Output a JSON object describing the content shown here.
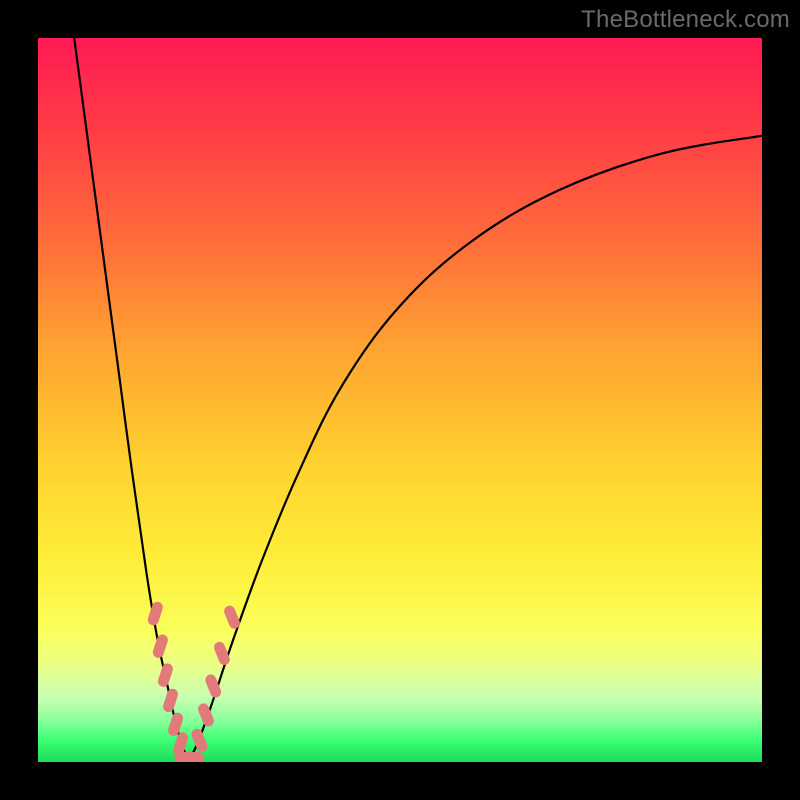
{
  "watermark": "TheBottleneck.com",
  "chart_data": {
    "type": "line",
    "title": "",
    "xlabel": "",
    "ylabel": "",
    "xlim": [
      0,
      100
    ],
    "ylim": [
      0,
      100
    ],
    "series": [
      {
        "name": "left-branch",
        "x": [
          5,
          7,
          9,
          11,
          13,
          15,
          16.5,
          18,
          19,
          20,
          20.8
        ],
        "y": [
          100,
          85,
          70,
          55,
          40,
          26,
          17,
          10,
          5.5,
          2,
          0.3
        ]
      },
      {
        "name": "right-branch",
        "x": [
          20.8,
          22,
          24,
          27,
          31,
          36,
          42,
          50,
          60,
          72,
          86,
          100
        ],
        "y": [
          0.3,
          2.5,
          8,
          17,
          28,
          40,
          52,
          63,
          72,
          79,
          84,
          86.5
        ]
      }
    ],
    "annotations": {
      "marker_cluster_description": "salmon-colored rounded dash markers clustered near the valley bottom on both branches",
      "marker_color": "#e27a7a",
      "markers": [
        {
          "branch": "left",
          "x": 16.2,
          "y": 20.5
        },
        {
          "branch": "left",
          "x": 16.9,
          "y": 16.0
        },
        {
          "branch": "left",
          "x": 17.6,
          "y": 12.0
        },
        {
          "branch": "left",
          "x": 18.3,
          "y": 8.5
        },
        {
          "branch": "left",
          "x": 19.0,
          "y": 5.2
        },
        {
          "branch": "left",
          "x": 19.7,
          "y": 2.5
        },
        {
          "branch": "valley",
          "x": 20.5,
          "y": 0.6
        },
        {
          "branch": "valley",
          "x": 21.3,
          "y": 0.6
        },
        {
          "branch": "right",
          "x": 22.3,
          "y": 3.0
        },
        {
          "branch": "right",
          "x": 23.2,
          "y": 6.5
        },
        {
          "branch": "right",
          "x": 24.2,
          "y": 10.5
        },
        {
          "branch": "right",
          "x": 25.4,
          "y": 15.0
        },
        {
          "branch": "right",
          "x": 26.8,
          "y": 20.0
        }
      ]
    }
  }
}
